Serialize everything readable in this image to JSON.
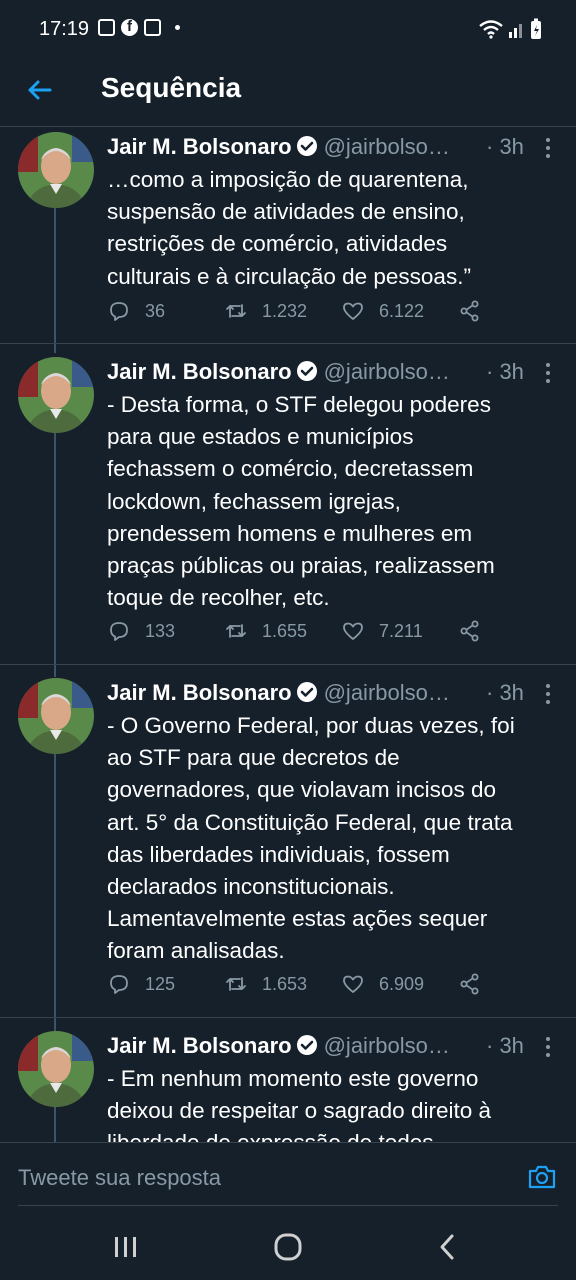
{
  "status": {
    "time": "17:19"
  },
  "appbar": {
    "title": "Sequência"
  },
  "tweets": [
    {
      "name": "Jair M. Bolsonaro",
      "handle": "@jairbolso…",
      "time": "· 3h",
      "text": "…como a imposição de quarentena,\nsuspensão de atividades de ensino,\nrestrições de comércio, atividades\nculturais e à circulação de pessoas.”",
      "replies": "36",
      "retweets": "1.232",
      "likes": "6.122"
    },
    {
      "name": "Jair M. Bolsonaro",
      "handle": "@jairbolso…",
      "time": "· 3h",
      "text": "- Desta forma, o STF delegou poderes\npara que estados e municípios\nfechassem o comércio, decretassem\nlockdown, fechassem igrejas,\nprendessem homens e mulheres em\npraças públicas ou praias, realizassem\ntoque de recolher, etc.",
      "replies": "133",
      "retweets": "1.655",
      "likes": "7.211"
    },
    {
      "name": "Jair M. Bolsonaro",
      "handle": "@jairbolso…",
      "time": "· 3h",
      "text": "- O Governo Federal, por duas vezes, foi\nao STF para que decretos de\ngovernadores, que violavam incisos do\nart. 5° da Constituição Federal, que trata\ndas liberdades individuais, fossem\ndeclarados inconstitucionais.\nLamentavelmente estas ações sequer\nforam analisadas.",
      "replies": "125",
      "retweets": "1.653",
      "likes": "6.909"
    },
    {
      "name": "Jair M. Bolsonaro",
      "handle": "@jairbolso…",
      "time": "· 3h",
      "text": "- Em nenhum momento este governo\ndeixou de respeitar o sagrado direito à\nliberdade de expressão de todos"
    }
  ],
  "reply": {
    "placeholder": "Tweete sua resposta"
  },
  "colors": {
    "background": "#15202b",
    "accent": "#1da1f2",
    "muted": "#8899a6",
    "divider": "#38444d"
  }
}
